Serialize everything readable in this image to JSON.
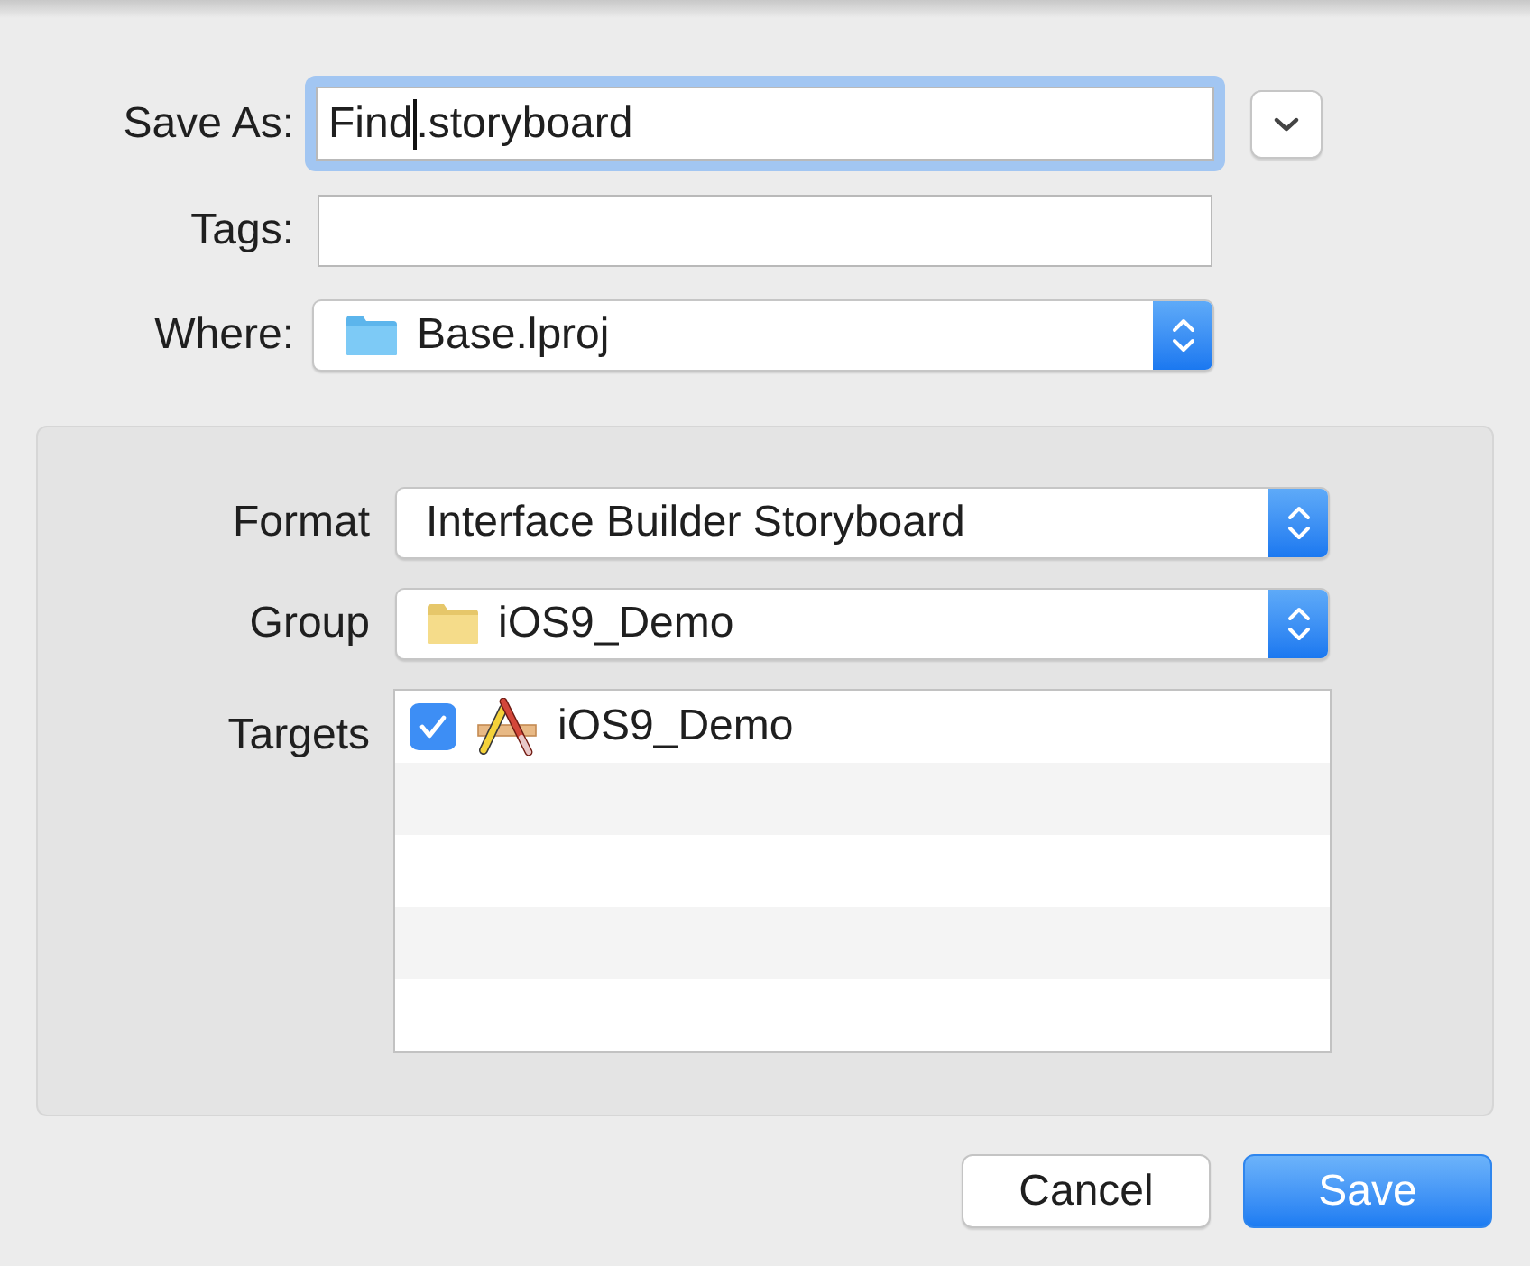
{
  "save_as": {
    "label": "Save As:",
    "value_before_cursor": "Find",
    "value_after_cursor": ".storyboard",
    "focused": true
  },
  "tags": {
    "label": "Tags:"
  },
  "where": {
    "label": "Where:",
    "value": "Base.lproj"
  },
  "options": {
    "format": {
      "label": "Format",
      "value": "Interface Builder Storyboard"
    },
    "group": {
      "label": "Group",
      "value": "iOS9_Demo"
    },
    "targets": {
      "label": "Targets",
      "items": [
        {
          "name": "iOS9_Demo",
          "checked": true
        }
      ]
    }
  },
  "buttons": [
    {
      "label": "Cancel",
      "kind": "default"
    },
    {
      "label": "Save",
      "kind": "primary"
    }
  ]
}
